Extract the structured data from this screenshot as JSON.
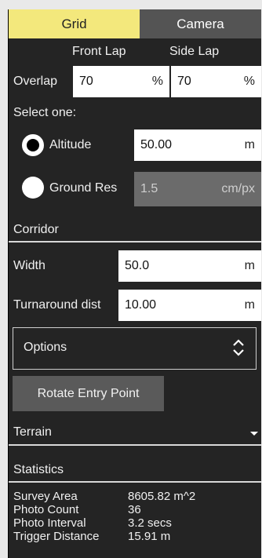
{
  "tabs": [
    {
      "label": "Grid",
      "active": true
    },
    {
      "label": "Camera",
      "active": false
    }
  ],
  "overlap": {
    "front_lap_header": "Front Lap",
    "side_lap_header": "Side Lap",
    "label": "Overlap",
    "front_value": "70",
    "front_unit": "%",
    "side_value": "70",
    "side_unit": "%"
  },
  "select_one": {
    "label": "Select one:",
    "altitude": {
      "label": "Altitude",
      "selected": true,
      "value": "50.00",
      "unit": "m"
    },
    "ground_res": {
      "label": "Ground Res",
      "selected": false,
      "value": "1.5",
      "unit": "cm/px"
    }
  },
  "corridor": {
    "title": "Corridor",
    "width_label": "Width",
    "width_value": "50.0",
    "width_unit": "m",
    "turnaround_label": "Turnaround dist",
    "turnaround_value": "10.00",
    "turnaround_unit": "m"
  },
  "options": {
    "label": "Options"
  },
  "rotate_button": "Rotate Entry Point",
  "terrain": {
    "title": "Terrain"
  },
  "statistics": {
    "title": "Statistics",
    "rows": [
      {
        "key": "Survey Area",
        "value": "8605.82 m^2"
      },
      {
        "key": "Photo Count",
        "value": "36"
      },
      {
        "key": "Photo Interval",
        "value": "3.2 secs"
      },
      {
        "key": "Trigger Distance",
        "value": "15.91 m"
      }
    ]
  },
  "colors": {
    "active_tab": "#f3e87c",
    "inactive_tab": "#545454",
    "panel_bg": "#242424",
    "button_bg": "#5a5a5a"
  }
}
